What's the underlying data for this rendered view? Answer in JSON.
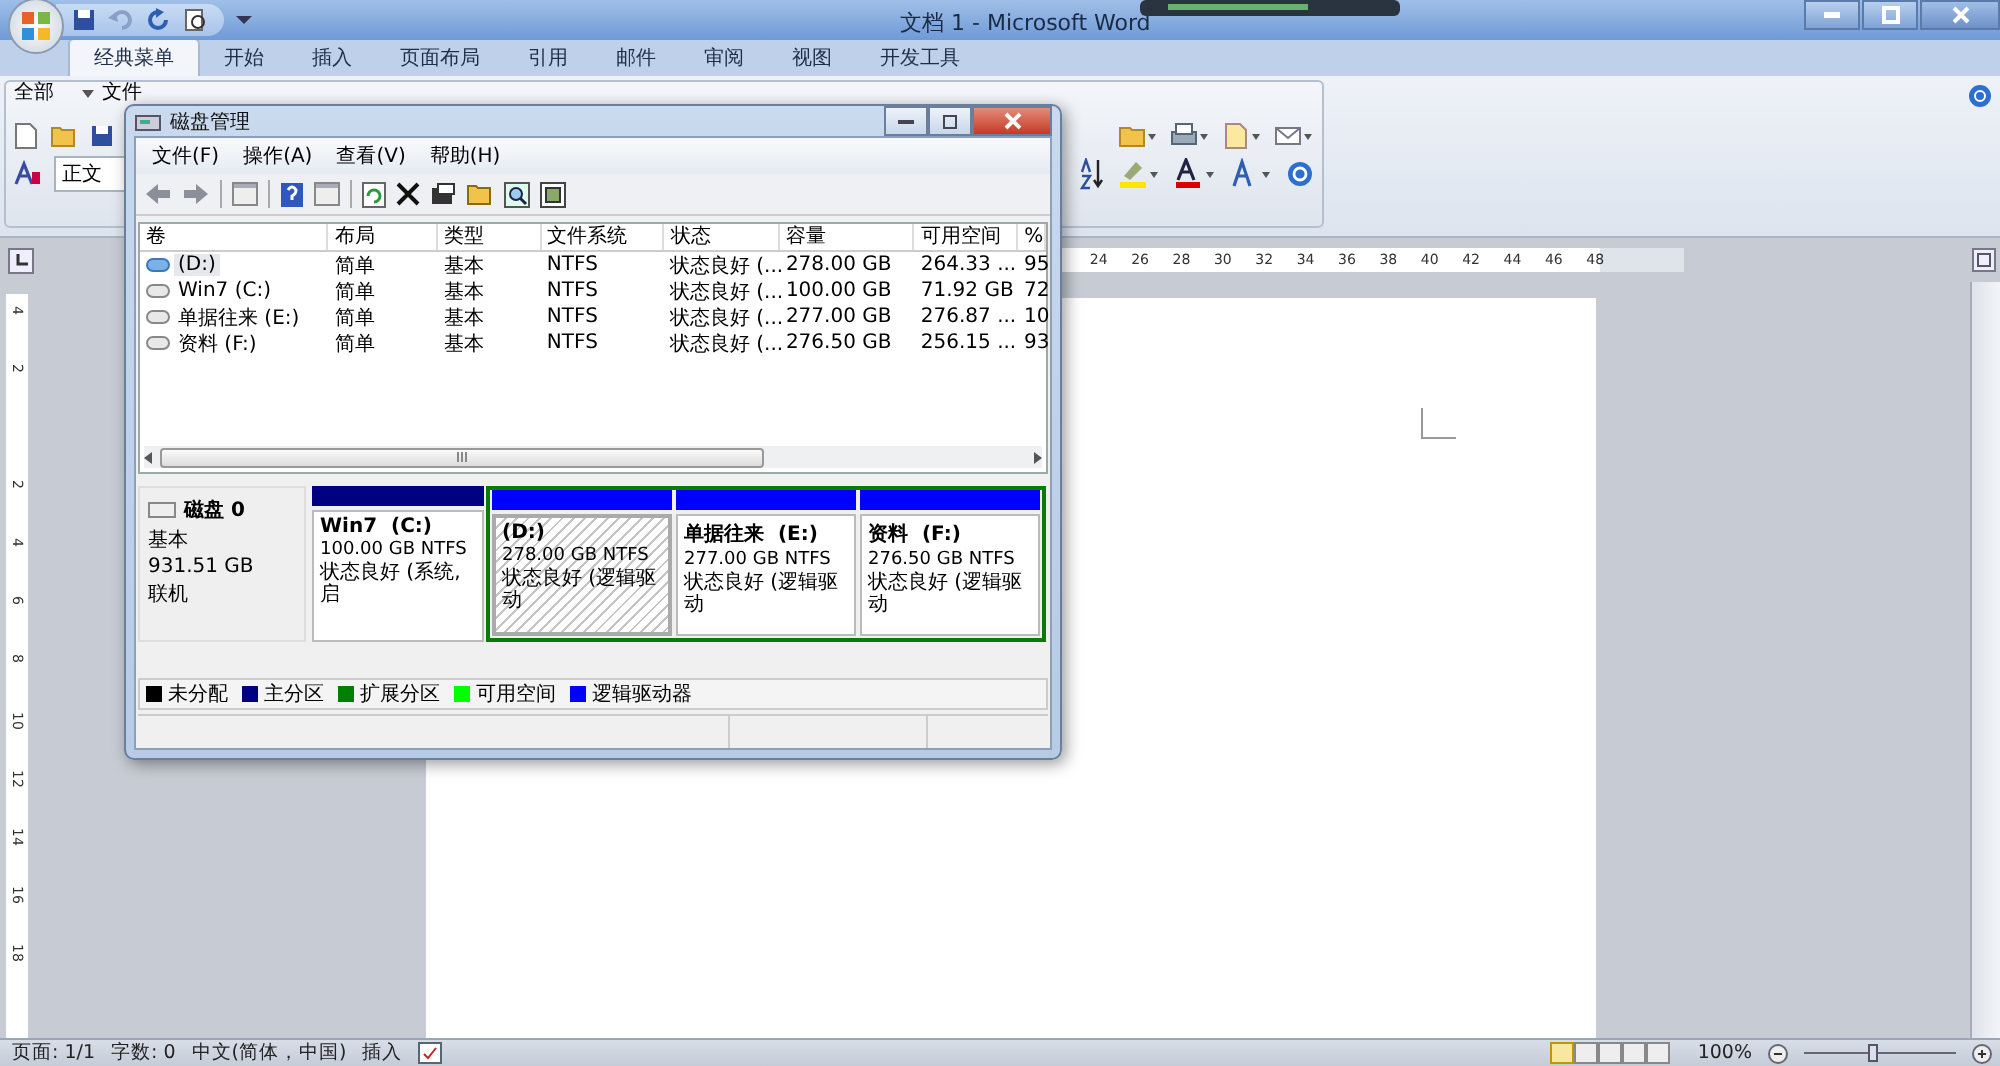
{
  "word": {
    "title": "文档 1 - Microsoft Word",
    "tabs": [
      {
        "label": "经典菜单",
        "selected": true
      },
      {
        "label": "开始",
        "selected": false
      },
      {
        "label": "插入",
        "selected": false
      },
      {
        "label": "页面布局",
        "selected": false
      },
      {
        "label": "引用",
        "selected": false
      },
      {
        "label": "邮件",
        "selected": false
      },
      {
        "label": "审阅",
        "selected": false
      },
      {
        "label": "视图",
        "selected": false
      },
      {
        "label": "开发工具",
        "selected": false
      }
    ],
    "menu": [
      "全部",
      "文件"
    ],
    "style_box": "正文",
    "ruler_numbers": [
      "24",
      "26",
      "28",
      "30",
      "32",
      "34",
      "36",
      "38",
      "40",
      "42",
      "44",
      "46",
      "48"
    ],
    "vertical_ruler_numbers": [
      "4",
      "2",
      "2",
      "4",
      "6",
      "8",
      "10",
      "12",
      "14",
      "16",
      "18"
    ],
    "status_bar": [
      "页面: 1/1",
      "字数: 0",
      "中文(简体，中国)",
      "插入"
    ],
    "zoom": "100%",
    "zoom_slider": {
      "level": 0.45
    }
  },
  "dialog": {
    "title": "磁盘管理",
    "menu": [
      "文件(F)",
      "操作(A)",
      "查看(V)",
      "帮助(H)"
    ],
    "columns": [
      "卷",
      "布局",
      "类型",
      "文件系统",
      "状态",
      "容量",
      "可用空间",
      "%"
    ],
    "rows": [
      {
        "cells": [
          "(D:)",
          "简单",
          "基本",
          "NTFS",
          "状态良好 (...",
          "278.00 GB",
          "264.33 ...",
          "95"
        ],
        "selected": true
      },
      {
        "cells": [
          "Win7 (C:)",
          "简单",
          "基本",
          "NTFS",
          "状态良好 (...",
          "100.00 GB",
          "71.92 GB",
          "72"
        ],
        "selected": false
      },
      {
        "cells": [
          "单据往来 (E:)",
          "简单",
          "基本",
          "NTFS",
          "状态良好 (...",
          "277.00 GB",
          "276.87 ...",
          "10"
        ],
        "selected": false
      },
      {
        "cells": [
          "资料 (F:)",
          "简单",
          "基本",
          "NTFS",
          "状态良好 (...",
          "276.50 GB",
          "256.15 ...",
          "93"
        ],
        "selected": false
      }
    ],
    "disk": {
      "name": "磁盘 0",
      "type": "基本",
      "size": "931.51 GB",
      "state": "联机"
    },
    "partitions": [
      {
        "kind": "primary",
        "color": "#000080",
        "name": "Win7  (C:)",
        "size": "100.00 GB NTFS",
        "status": "状态良好 (系统, 启",
        "selected": false
      },
      {
        "kind": "extended",
        "children": [
          {
            "kind": "logical",
            "color": "#0000ff",
            "name": "(D:)",
            "size": "278.00 GB NTFS",
            "status": "状态良好 (逻辑驱动",
            "selected": true
          },
          {
            "kind": "logical",
            "color": "#0000ff",
            "name": "单据往来  (E:)",
            "size": "277.00 GB NTFS",
            "status": "状态良好 (逻辑驱动",
            "selected": false
          },
          {
            "kind": "logical",
            "color": "#0000ff",
            "name": "资料  (F:)",
            "size": "276.50 GB NTFS",
            "status": "状态良好 (逻辑驱动",
            "selected": false
          }
        ]
      }
    ],
    "legend": [
      {
        "label": "未分配",
        "color": "#000000"
      },
      {
        "label": "主分区",
        "color": "#000080"
      },
      {
        "label": "扩展分区",
        "color": "#008000"
      },
      {
        "label": "可用空间",
        "color": "#00ff00"
      },
      {
        "label": "逻辑驱动器",
        "color": "#0000ff"
      }
    ]
  }
}
